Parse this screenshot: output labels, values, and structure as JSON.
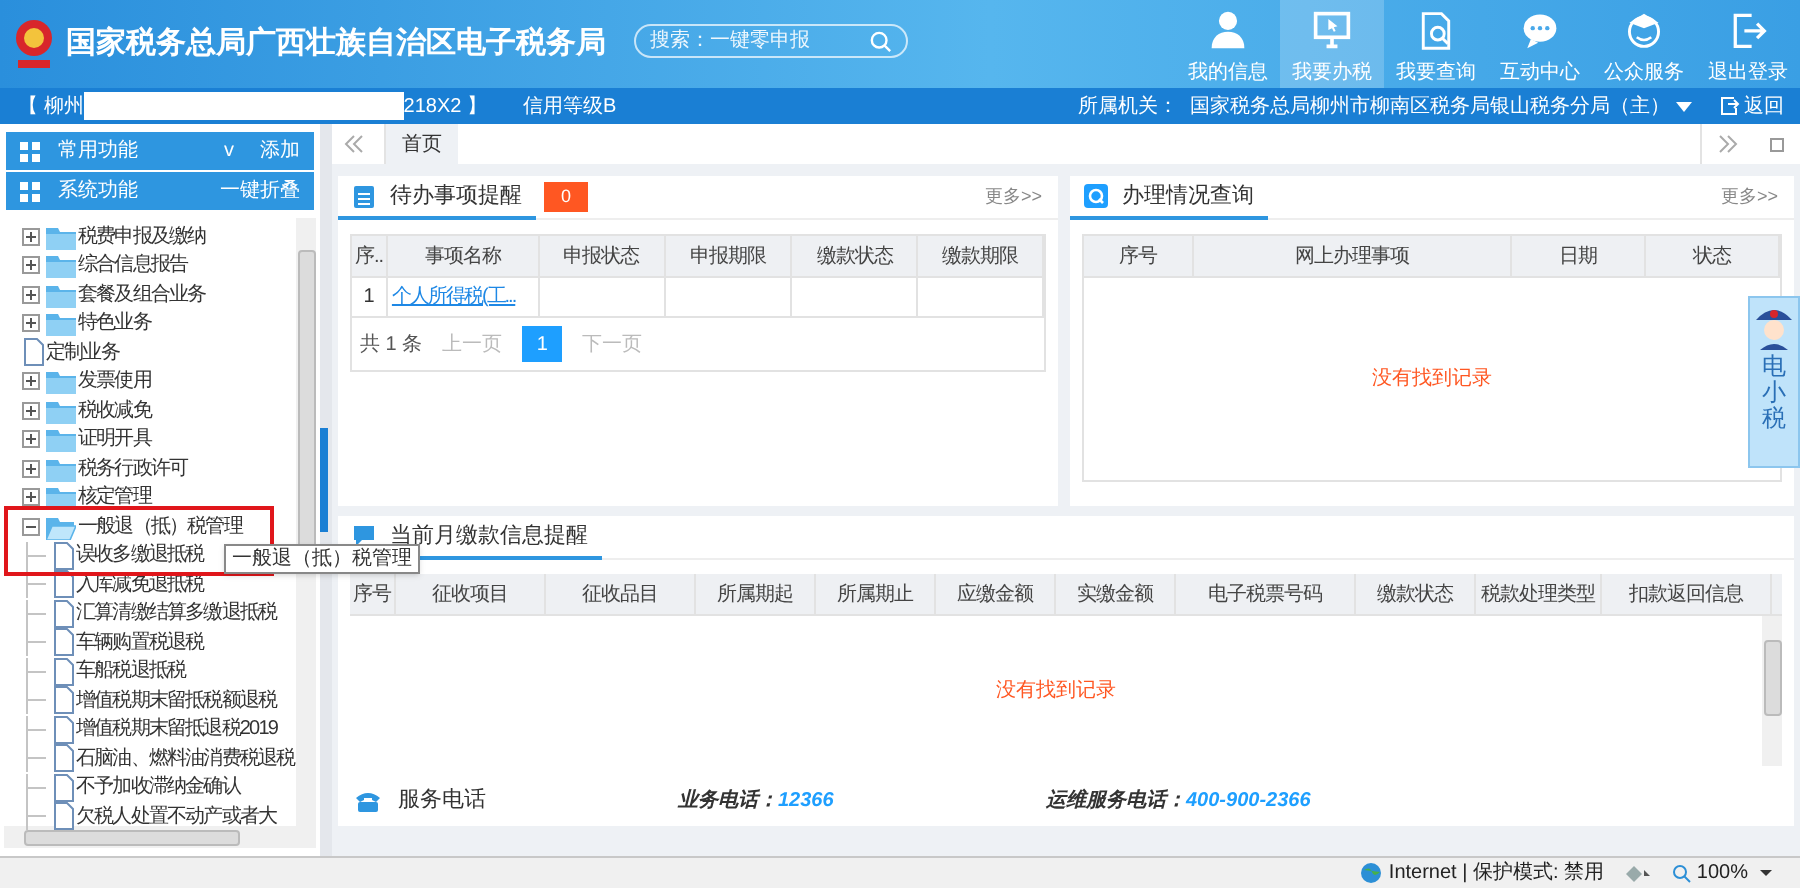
{
  "header": {
    "title": "国家税务总局广西壮族自治区电子税务局",
    "search": {
      "placeholder": "搜索：一键零申报"
    },
    "nav": [
      {
        "label": "我的信息",
        "selected": false
      },
      {
        "label": "我要办税",
        "selected": true
      },
      {
        "label": "我要查询",
        "selected": false
      },
      {
        "label": "互动中心",
        "selected": false
      },
      {
        "label": "公众服务",
        "selected": false
      },
      {
        "label": "退出登录",
        "selected": false
      }
    ]
  },
  "info_bar": {
    "taxpayer_start": "【 柳州",
    "taxpayer_end": "218X2 】",
    "credit": "信用等级B",
    "office_label": "所属机关：",
    "office": "国家税务总局柳州市柳南区税务局银山税务分局（主）",
    "back": "返回"
  },
  "sidebar": {
    "panels": [
      {
        "label": "常用功能",
        "toggle": "v",
        "action": "添加"
      },
      {
        "label": "系统功能",
        "action": "一键折叠"
      }
    ],
    "tree": [
      {
        "kind": "folder",
        "label": "税费申报及缴纳",
        "expanded": false
      },
      {
        "kind": "folder",
        "label": "综合信息报告",
        "expanded": false
      },
      {
        "kind": "folder",
        "label": "套餐及组合业务",
        "expanded": false
      },
      {
        "kind": "folder",
        "label": "特色业务",
        "expanded": false
      },
      {
        "kind": "doc",
        "label": "定制业务"
      },
      {
        "kind": "folder",
        "label": "发票使用",
        "expanded": false
      },
      {
        "kind": "folder",
        "label": "税收减免",
        "expanded": false
      },
      {
        "kind": "folder",
        "label": "证明开具",
        "expanded": false
      },
      {
        "kind": "folder",
        "label": "税务行政许可",
        "expanded": false
      },
      {
        "kind": "folder",
        "label": "核定管理",
        "expanded": false
      },
      {
        "kind": "folder",
        "label": "一般退（抵）税管理",
        "expanded": true,
        "highlighted": true,
        "children": [
          {
            "kind": "doc",
            "label": "误收多缴退抵税"
          },
          {
            "kind": "doc",
            "label": "入库减免退抵税"
          },
          {
            "kind": "doc",
            "label": "汇算清缴结算多缴退抵税"
          },
          {
            "kind": "doc",
            "label": "车辆购置税退税"
          },
          {
            "kind": "doc",
            "label": "车船税退抵税"
          },
          {
            "kind": "doc",
            "label": "增值税期末留抵税额退税"
          },
          {
            "kind": "doc",
            "label": "增值税期末留抵退税2019"
          },
          {
            "kind": "doc",
            "label": "石脑油、燃料油消费税退税"
          },
          {
            "kind": "doc",
            "label": "不予加收滞纳金确认"
          },
          {
            "kind": "doc",
            "label": "欠税人处置不动产或者大"
          }
        ]
      }
    ]
  },
  "tooltip": "一般退（抵）税管理",
  "tabs": [
    {
      "label": "首页",
      "selected": true
    }
  ],
  "todo_panel": {
    "title": "待办事项提醒",
    "count": "0",
    "more": "更多>>",
    "columns": [
      "序..",
      "事项名称",
      "申报状态",
      "申报期限",
      "缴款状态",
      "缴款期限"
    ],
    "rows": [
      [
        "1",
        "个人所得税(工...",
        "",
        "",
        "",
        ""
      ]
    ],
    "pager": {
      "total": "共 1 条",
      "prev": "上一页",
      "pages": [
        {
          "label": "1",
          "selected": true
        }
      ],
      "next": "下一页"
    }
  },
  "query_panel": {
    "title": "办理情况查询",
    "more": "更多>>",
    "columns": [
      "序号",
      "网上办理事项",
      "日期",
      "状态"
    ],
    "empty": "没有找到记录"
  },
  "payment_panel": {
    "title": "当前月缴款信息提醒",
    "columns": [
      "序号",
      "征收项目",
      "征收品目",
      "所属期起",
      "所属期止",
      "应缴金额",
      "实缴金额",
      "电子税票号码",
      "缴款状态",
      "税款处理类型",
      "扣款返回信息"
    ],
    "empty": "没有找到记录"
  },
  "service": {
    "title": "服务电话",
    "items": [
      {
        "label": "业务电话：",
        "value": "12366"
      },
      {
        "label": "运维服务电话：",
        "value": "400-900-2366"
      }
    ]
  },
  "assistant": {
    "label": "电小税"
  },
  "status_bar": {
    "zone": "Internet | 保护模式: 禁用",
    "zoom": "100%"
  }
}
